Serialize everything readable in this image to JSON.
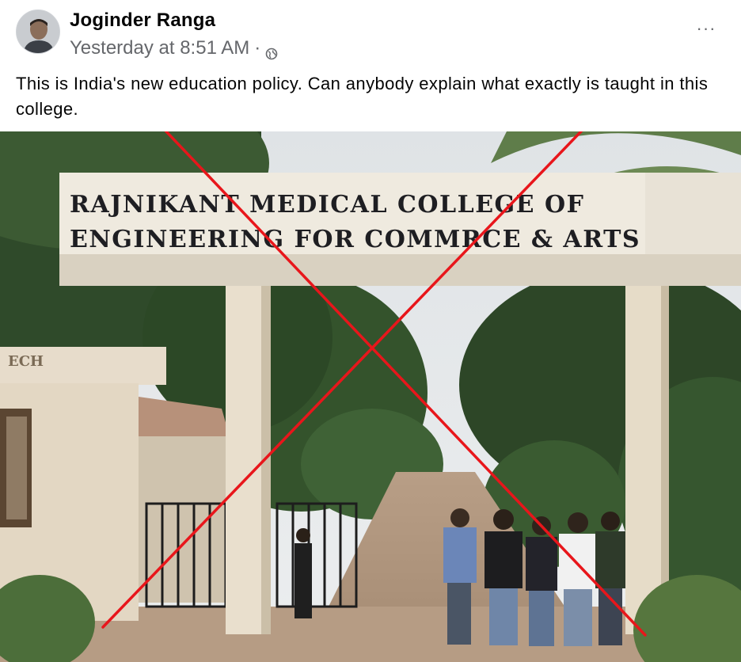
{
  "post": {
    "author": "Joginder Ranga",
    "timestamp": "Yesterday at 8:51 AM",
    "separator": "·",
    "privacy_icon": "globe-icon",
    "more_icon": "more-options-icon",
    "more_label": "···",
    "caption": "This is India's new education policy. Can anybody explain what exactly is taught in this college."
  },
  "photo": {
    "sign_line_1": "RAJNIKANT MEDICAL COLLEGE OF",
    "sign_line_2": "ENGINEERING FOR COMMRCE & ARTS",
    "side_sign": "ECH",
    "overlay": "red-x-cross",
    "overlay_color": "#e8161b"
  }
}
